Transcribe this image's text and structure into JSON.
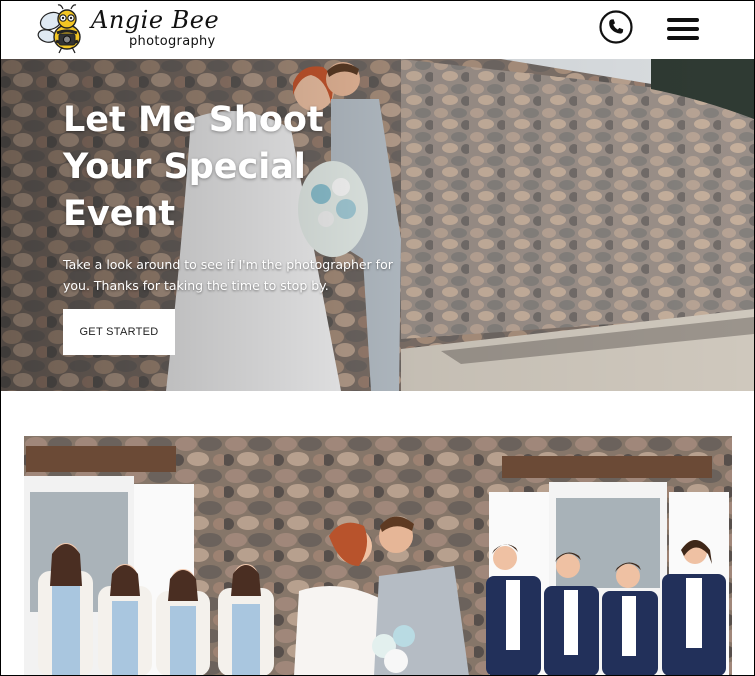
{
  "header": {
    "logo_title": "Angie Bee",
    "logo_subtitle": "photography",
    "phone_icon": "phone-icon",
    "menu_icon": "hamburger-menu-icon"
  },
  "hero": {
    "title": "Let Me Shoot Your Special Event",
    "text": "Take a look around to see if I'm the photographer for you. Thanks for taking the time to stop by.",
    "cta_label": "GET STARTED"
  },
  "colors": {
    "text": "#111111",
    "hero_text": "#ffffff",
    "button_bg": "#ffffff"
  }
}
